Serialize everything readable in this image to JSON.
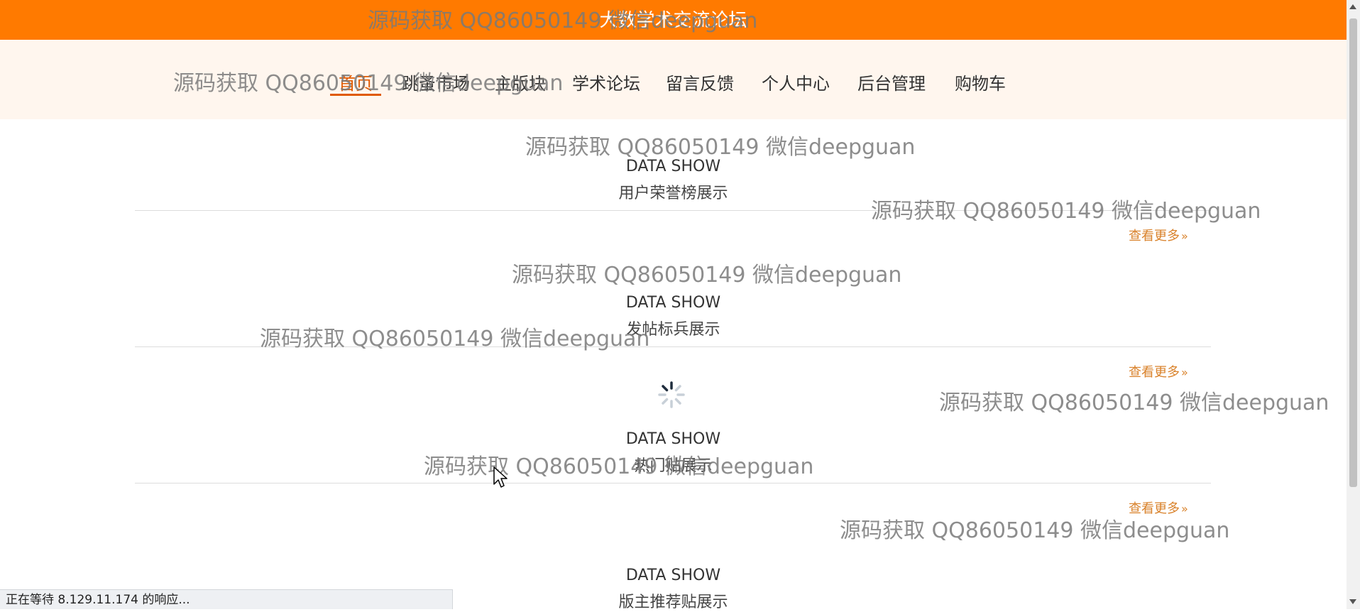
{
  "header": {
    "site_title": "大数学术交流论坛"
  },
  "nav": {
    "items": [
      {
        "label": "首页",
        "active": true
      },
      {
        "label": "跳蚤市场"
      },
      {
        "label": "主版块"
      },
      {
        "label": "学术论坛"
      },
      {
        "label": "留言反馈"
      },
      {
        "label": "个人中心"
      },
      {
        "label": "后台管理"
      },
      {
        "label": "购物车"
      }
    ]
  },
  "sections": [
    {
      "en": "DATA SHOW",
      "cn": "用户荣誉榜展示",
      "more": "查看更多"
    },
    {
      "en": "DATA SHOW",
      "cn": "发帖标兵展示",
      "more": "查看更多"
    },
    {
      "en": "DATA SHOW",
      "cn": "热门贴展示",
      "more": "查看更多"
    },
    {
      "en": "DATA SHOW",
      "cn": "版主推荐贴展示"
    }
  ],
  "watermark_text": "源码获取 QQ86050149 微信deepguan",
  "status_bar": {
    "text": "正在等待 8.129.11.174 的响应..."
  },
  "colors": {
    "header_bg": "#ff7a00",
    "nav_bg": "#fff6ee",
    "accent": "#e05a00",
    "more_link": "#d9822b"
  },
  "icons": {
    "spinner": "loading-spinner-icon",
    "more_chevron": "double-chevron-right-icon",
    "cursor": "mouse-pointer-icon"
  }
}
